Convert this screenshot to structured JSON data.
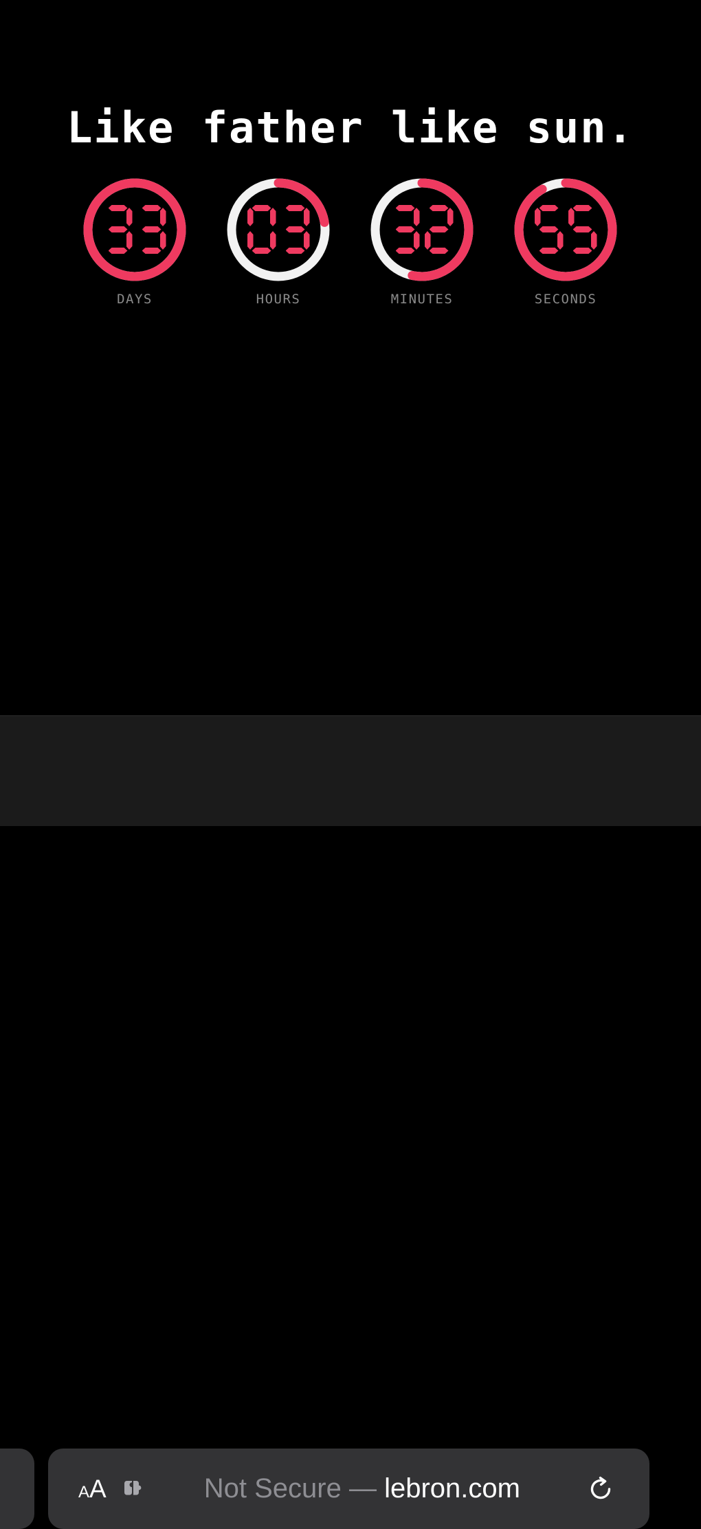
{
  "page": {
    "background_color": "#000000",
    "headline": "Like father like sun.",
    "accent_color": "#ef3a60",
    "track_color": "#f2f2f2",
    "label_color": "#8a8a8a"
  },
  "countdown": {
    "units": [
      {
        "label": "DAYS",
        "value": "33",
        "d0": "3",
        "d1": "3",
        "fraction": 1.0,
        "arc_degrees": 360
      },
      {
        "label": "HOURS",
        "value": "03",
        "d0": "0",
        "d1": "3",
        "fraction": 0.225,
        "arc_degrees": 81
      },
      {
        "label": "MINUTES",
        "value": "32",
        "d0": "3",
        "d1": "2",
        "fraction": 0.533,
        "arc_degrees": 192
      },
      {
        "label": "SECONDS",
        "value": "55",
        "d0": "5",
        "d1": "5",
        "fraction": 0.917,
        "arc_degrees": 330
      }
    ]
  },
  "browser": {
    "bar_background": "#1b1b1b",
    "pill_background": "#333335",
    "text_size_button": {
      "small": "A",
      "large": "A",
      "name": "AA"
    },
    "extensions_icon": "puzzle-piece-icon",
    "reload_icon": "reload-icon",
    "address": {
      "status": "Not Secure",
      "separator": "—",
      "domain": "lebron.com",
      "full": "Not Secure — lebron.com"
    },
    "previous_tab": {
      "label": ""
    }
  }
}
